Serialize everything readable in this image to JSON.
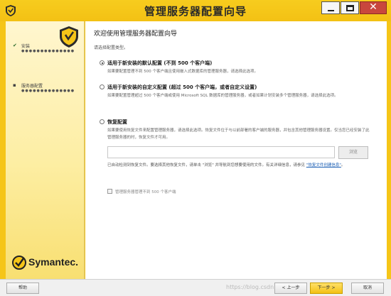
{
  "window": {
    "title": "管理服务器配置向导",
    "close_glyph": "✕"
  },
  "sidebar": {
    "steps": [
      {
        "label": "安装",
        "dots": "●●●●●●●●●●●●●●",
        "state": "done",
        "mark": "✔"
      },
      {
        "label": "服务器配置",
        "dots": "●●●●●●●●●●●●●●",
        "state": "current",
        "mark": "▪"
      }
    ],
    "brand": "Symantec."
  },
  "main": {
    "title": "欢迎使用管理服务器配置向导",
    "prompt": "请选择配置类型。",
    "options": [
      {
        "label": "适用于新安装的默认配置 (不到 500 个客户端)",
        "desc": "如果要配置管理不到 500 个客户端且使用嵌入式数据库的管理服务器，请选择此选项。",
        "selected": true
      },
      {
        "label": "适用于新安装的自定义配置 (超过 500 个客户端，或者自定义设置)",
        "desc": "如果要配置管理超过 500 个客户端或使用 Microsoft SQL 数据库的管理服务器，或者如果计划安装多个管理服务器，请选择此选项。",
        "selected": false
      },
      {
        "label": "恢复配置",
        "desc": "如果要使用恢复文件来配置管理服务器，请选择此选项。恢复文件位于与以前部署的客户端的服务器，并包含其他管理服务器设置。仅当您已经安装了此管理服务器的时，恢复文件才可用。",
        "selected": false
      }
    ],
    "recovery_path": {
      "value": "",
      "placeholder": ""
    },
    "browse_label": "浏览",
    "hint_text": "已自动检测到恢复文件。要选择其他恢复文件，请单击 \"浏览\" 并导航到您想要使用的文件。有关详细信息，请参见",
    "hint_link": "\"恢复文件创建信息\"",
    "hint_end": "。",
    "checkbox_label": "管理服务器管理不到 500 个客户端",
    "checkbox_checked": false
  },
  "footer": {
    "help": "帮助",
    "back": "< 上一步",
    "next": "下一步 >",
    "cancel": "取消",
    "watermark": "https://blog.csdn.net/..."
  },
  "colors": {
    "accent": "#f5c518",
    "link": "#1c5fb4",
    "close_button": "#c9473d"
  },
  "icons": {
    "app": "symantec-shield-icon",
    "sidebar_logo": "symantec-shield-icon",
    "brand_mark": "checkmark-circle-icon",
    "step_done": "check-icon",
    "step_current": "bullet-icon"
  }
}
